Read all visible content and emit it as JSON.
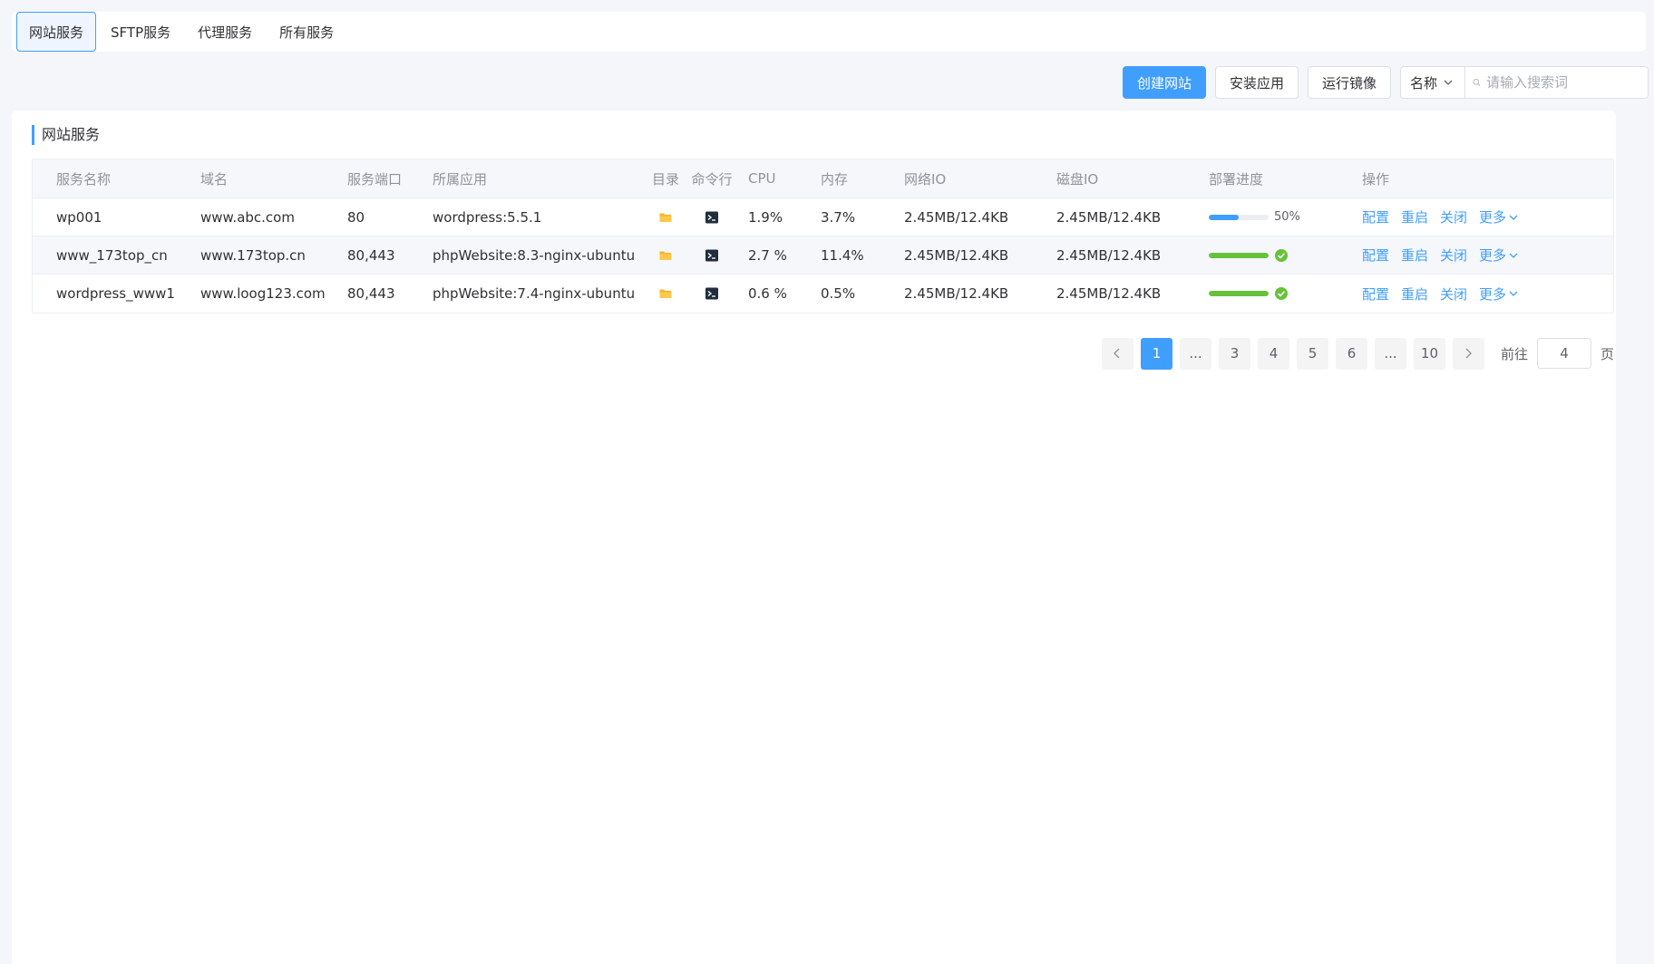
{
  "tabs": [
    {
      "label": "网站服务",
      "active": true
    },
    {
      "label": "SFTP服务",
      "active": false
    },
    {
      "label": "代理服务",
      "active": false
    },
    {
      "label": "所有服务",
      "active": false
    }
  ],
  "toolbar": {
    "create_label": "创建网站",
    "install_label": "安装应用",
    "run_image_label": "运行镜像",
    "search_field": "名称",
    "search_placeholder": "请输入搜索词"
  },
  "card": {
    "title": "网站服务"
  },
  "table": {
    "headers": {
      "name": "服务名称",
      "domain": "域名",
      "port": "服务端口",
      "app": "所属应用",
      "dir": "目录",
      "cmd": "命令行",
      "cpu": "CPU",
      "mem": "内存",
      "net": "网络IO",
      "disk": "磁盘IO",
      "progress": "部署进度",
      "ops": "操作"
    },
    "rows": [
      {
        "name": "wp001",
        "domain": "www.abc.com",
        "port": "80",
        "app": "wordpress:5.5.1",
        "cpu": "1.9%",
        "mem": "3.7%",
        "net": "2.45MB/12.4KB",
        "disk": "2.45MB/12.4KB",
        "progress": 0.5,
        "progress_label": "50%",
        "done": false
      },
      {
        "name": "www_173top_cn",
        "domain": "www.173top.cn",
        "port": "80,443",
        "app": "phpWebsite:8.3-nginx-ubuntu",
        "cpu": "2.7 %",
        "mem": "11.4%",
        "net": "2.45MB/12.4KB",
        "disk": "2.45MB/12.4KB",
        "progress": 1.0,
        "progress_label": "",
        "done": true
      },
      {
        "name": "wordpress_www1",
        "domain": "www.loog123.com",
        "port": "80,443",
        "app": "phpWebsite:7.4-nginx-ubuntu",
        "cpu": "0.6 %",
        "mem": "0.5%",
        "net": "2.45MB/12.4KB",
        "disk": "2.45MB/12.4KB",
        "progress": 1.0,
        "progress_label": "",
        "done": true
      }
    ],
    "ops": {
      "config": "配置",
      "restart": "重启",
      "close": "关闭",
      "more": "更多"
    }
  },
  "pagination": {
    "pages": [
      "1",
      "...",
      "3",
      "4",
      "5",
      "6",
      "...",
      "10"
    ],
    "current": "1",
    "goto_prefix": "前往",
    "goto_value": "4",
    "goto_suffix": "页"
  },
  "colors": {
    "accent": "#409eff",
    "success": "#67c23a",
    "folder": "#f7b52c",
    "terminal": "#1f2d3d"
  }
}
